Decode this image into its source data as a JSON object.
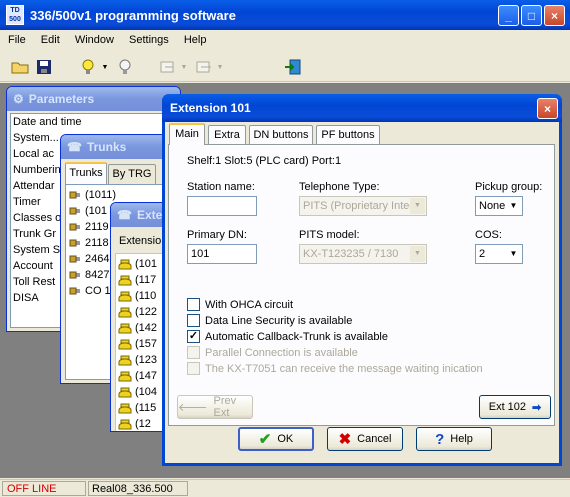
{
  "app": {
    "logo_top": "TD",
    "logo_bottom": "500",
    "title": "336/500v1 programming software"
  },
  "menu": [
    "File",
    "Edit",
    "Window",
    "Settings",
    "Help"
  ],
  "parameters": {
    "title": "Parameters",
    "items": [
      "Date and time",
      "System...",
      "Local ac",
      "Numberin",
      "Attendar",
      "Timer",
      "Classes o",
      "Trunk Gr",
      "System S",
      "Account",
      "Toll Rest",
      "DISA"
    ]
  },
  "trunks": {
    "title": "Trunks",
    "tabs": [
      "Trunks",
      "By TRG"
    ],
    "items": [
      "(1011)",
      "(101",
      "2119",
      "2118",
      "2464",
      "8427",
      "CO 1"
    ]
  },
  "extensions_win": {
    "title": "Exte",
    "column": "Extensio",
    "items": [
      "(101",
      "(117",
      "(110",
      "(122",
      "(142",
      "(157",
      "(123",
      "(147",
      "(104",
      "(115",
      "(12"
    ]
  },
  "dialog": {
    "title": "Extension 101",
    "tabs": [
      "Main",
      "Extra",
      "DN buttons",
      "PF buttons"
    ],
    "location": "Shelf:1 Slot:5 (PLC card) Port:1",
    "station_name_label": "Station name:",
    "station_name_value": "",
    "telephone_type_label": "Telephone Type:",
    "telephone_type_value": "PITS (Proprietary Integ",
    "pickup_group_label": "Pickup group:",
    "pickup_group_value": "None",
    "primary_dn_label": "Primary DN:",
    "primary_dn_value": "101",
    "pits_model_label": "PITS model:",
    "pits_model_value": "KX-T123235 / 7130",
    "cos_label": "COS:",
    "cos_value": "2",
    "checkboxes": [
      {
        "label": "With OHCA circuit",
        "checked": false,
        "enabled": true
      },
      {
        "label": "Data Line Security is available",
        "checked": false,
        "enabled": true
      },
      {
        "label": "Automatic Callback-Trunk is available",
        "checked": true,
        "enabled": true
      },
      {
        "label": "Parallel Connection is available",
        "checked": false,
        "enabled": false
      },
      {
        "label": "The KX-T7051 can receive the message waiting inication",
        "checked": false,
        "enabled": false
      }
    ],
    "prev_label": "Prev Ext",
    "next_label": "Ext 102",
    "ok_label": "OK",
    "cancel_label": "Cancel",
    "help_label": "Help"
  },
  "status": {
    "state": "OFF LINE",
    "file": "Real08_336.500"
  },
  "colors": {
    "title_blue": "#0046d4",
    "offline_red": "#d40000",
    "check_green": "#21a121"
  }
}
